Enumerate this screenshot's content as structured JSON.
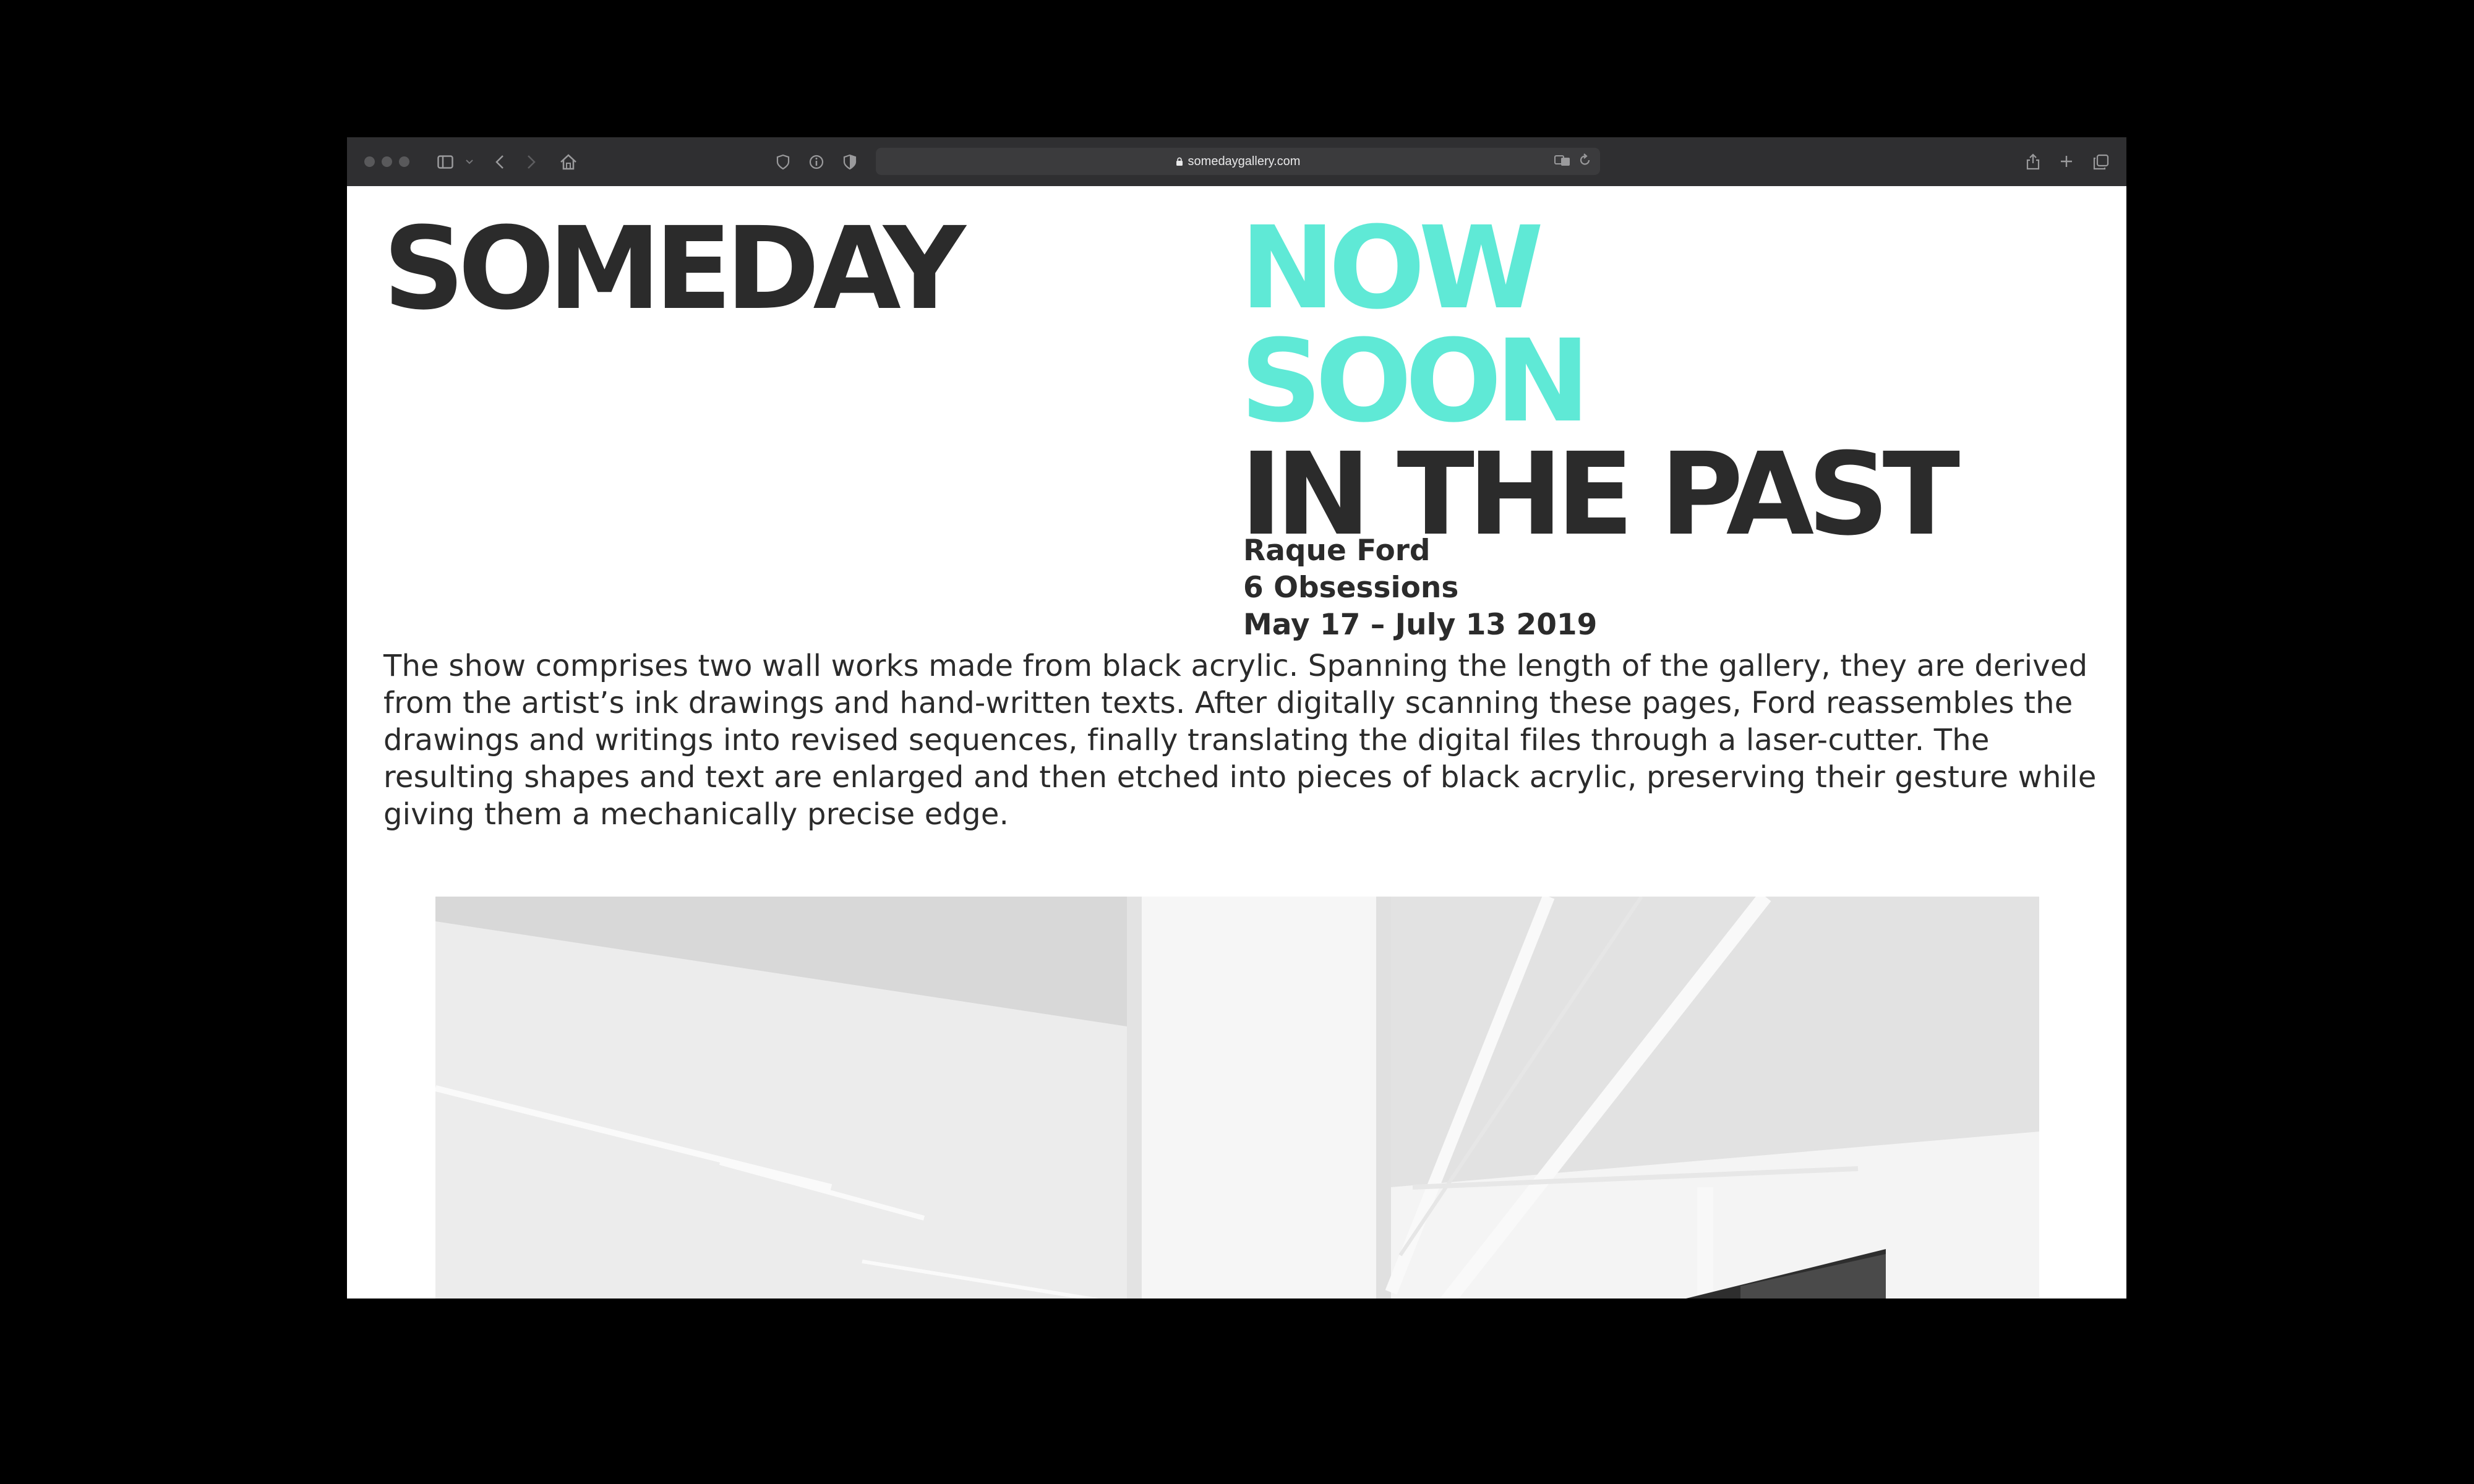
{
  "browser": {
    "url": "somedaygallery.com",
    "icons": [
      "window-dots",
      "sidebar-icon",
      "chevron-down-icon",
      "back-icon",
      "forward-icon",
      "home-icon",
      "shield-icon",
      "info-icon",
      "half-shield-icon",
      "lock-icon",
      "translate-icon",
      "reload-icon",
      "share-icon",
      "new-tab-icon",
      "tabs-icon"
    ]
  },
  "site": {
    "brand": "SOMEDAY",
    "nav": [
      "NOW",
      "SOON",
      "IN THE PAST"
    ],
    "exhibition": {
      "artist": "Raque Ford",
      "title": "6 Obsessions",
      "dates": "May 17 – July 13 2019"
    },
    "description": "The show comprises two wall works made from black acrylic. Spanning the length of the gallery, they are derived from the artist’s ink drawings and hand-written texts. After digitally scanning these pages, Ford reassembles the drawings and writings into revised sequences, finally translating the digital files through a laser-cutter. The resulting shapes and text are enlarged and then etched into pieces of black acrylic, preserving their gesture while giving them a mechanically precise edge."
  },
  "colors": {
    "accent": "#5fe9d6",
    "text": "#2b2b2b",
    "toolbar": "#2f2f31"
  }
}
